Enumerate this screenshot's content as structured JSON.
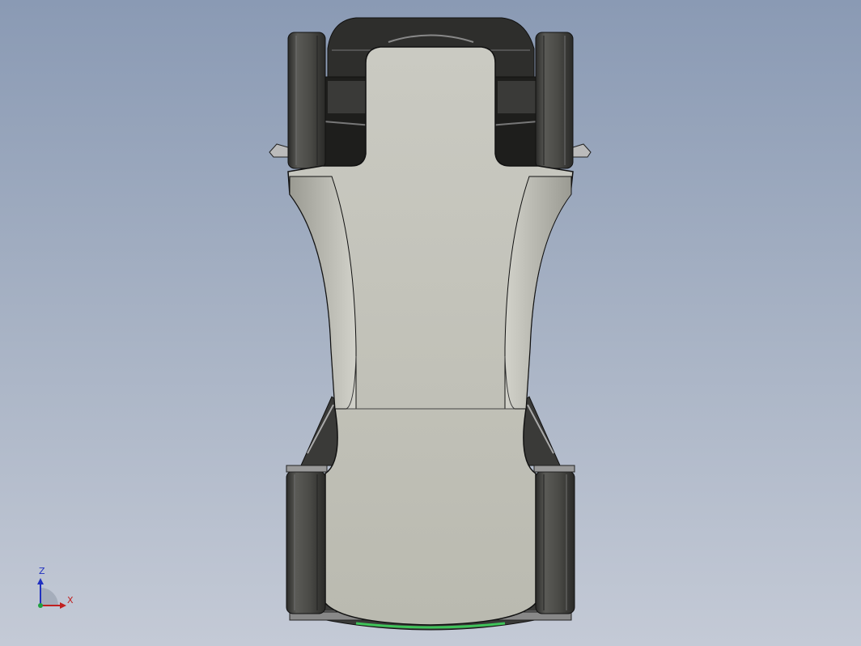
{
  "viewport": {
    "background_top": "#8a9ab4",
    "background_bottom": "#c4cad6"
  },
  "model": {
    "body_color": "#c2c2b8",
    "tire_color": "#4a4a48",
    "edge_color": "#1a1a1a",
    "accent_color": "#3fc45a"
  },
  "triad": {
    "z_label": "Z",
    "x_label": "X",
    "z_color": "#2030c0",
    "x_color": "#c02020",
    "y_color": "#20a040"
  }
}
